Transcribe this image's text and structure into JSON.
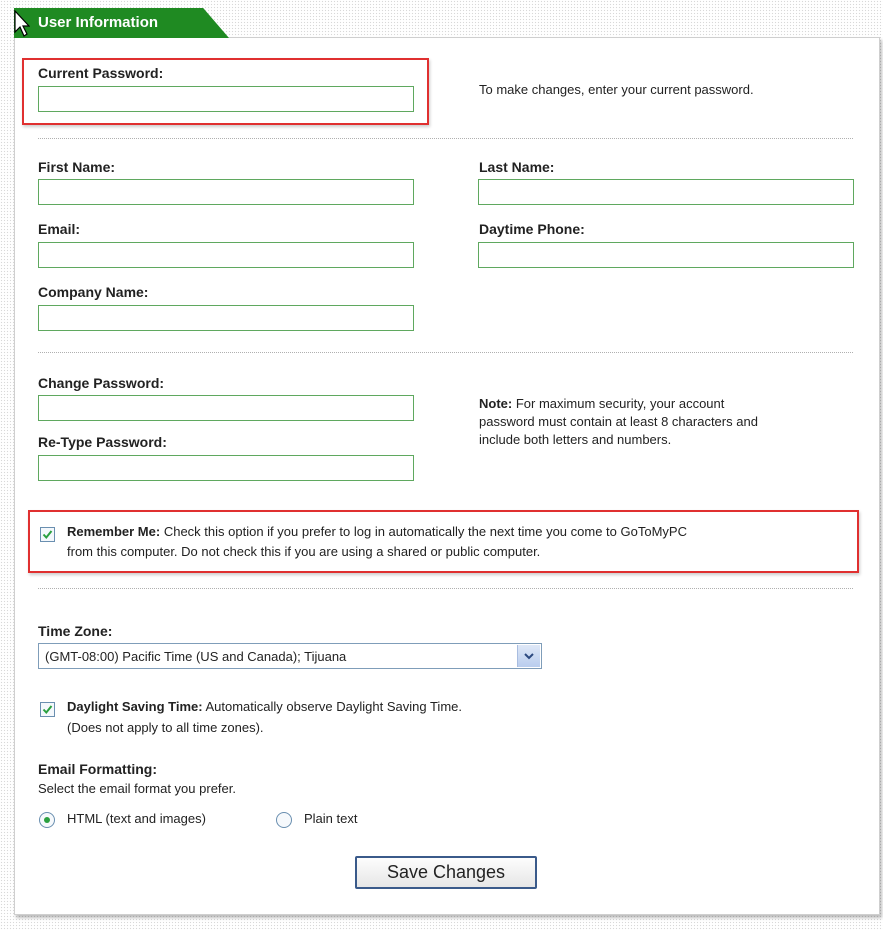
{
  "header": {
    "tab_title": "User Information"
  },
  "current_password": {
    "label": "Current Password:",
    "value": "",
    "hint": "To make changes, enter your current password."
  },
  "profile": {
    "first_name_label": "First Name:",
    "first_name_value": "",
    "last_name_label": "Last Name:",
    "last_name_value": "",
    "email_label": "Email:",
    "email_value": "",
    "phone_label": "Daytime Phone:",
    "phone_value": "",
    "company_label": "Company Name:",
    "company_value": ""
  },
  "password_change": {
    "change_label": "Change Password:",
    "change_value": "",
    "retype_label": "Re-Type Password:",
    "retype_value": "",
    "note_title": "Note:",
    "note_line1": "For maximum security, your account",
    "note_line2": "password must contain at least 8 characters and",
    "note_line3": "include both letters and numbers."
  },
  "remember_me": {
    "checked": true,
    "label": "Remember Me:",
    "text1": "Check this option if you prefer to log in automatically the next time you come to GoToMyPC",
    "text2": "from this computer. Do not check this if you are using a shared or public computer."
  },
  "time_zone": {
    "label": "Time Zone:",
    "selected": "(GMT-08:00) Pacific Time (US and Canada); Tijuana"
  },
  "dst": {
    "checked": true,
    "label": "Daylight Saving Time:",
    "text": "Automatically observe Daylight Saving Time.",
    "subtext": "(Does not apply to all time zones)."
  },
  "email_format": {
    "label": "Email Formatting:",
    "instruction": "Select the email format you prefer.",
    "options": [
      "HTML (text and images)",
      "Plain text"
    ],
    "selected": "HTML (text and images)"
  },
  "actions": {
    "save_label": "Save Changes"
  },
  "colors": {
    "tab": "#1f8a22",
    "highlight": "#e03030",
    "field_border": "#5fa85f"
  }
}
